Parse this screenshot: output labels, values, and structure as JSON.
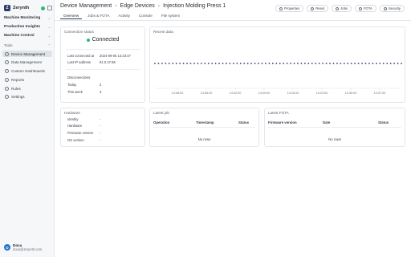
{
  "brand": {
    "name": "Zerynth",
    "logo_letter": "Z"
  },
  "sidebar": {
    "groups": [
      {
        "label": "Machine Monitoring"
      },
      {
        "label": "Production Insights"
      },
      {
        "label": "Machine Control"
      }
    ],
    "section": "Tools",
    "items": [
      {
        "label": "Device Management",
        "icon": "gear-icon",
        "active": true
      },
      {
        "label": "Data Management",
        "icon": "database-icon"
      },
      {
        "label": "Custom Dashboards",
        "icon": "dashboard-icon"
      },
      {
        "label": "Reports",
        "icon": "report-icon"
      },
      {
        "label": "Rules",
        "icon": "rules-icon"
      },
      {
        "label": "Settings",
        "icon": "settings-icon"
      }
    ],
    "user": {
      "initial": "D",
      "name": "Doca",
      "email": "doca@zerynth.com"
    }
  },
  "header": {
    "crumbs": [
      "Device Management",
      "Edge Devices",
      "Injection Molding Press 1"
    ],
    "actions": [
      "Properties",
      "Reset",
      "Jobs",
      "FOTA",
      "Security"
    ],
    "tabs": [
      "Overview",
      "Jobs & FOTA",
      "Activity",
      "Console",
      "File system"
    ],
    "active_tab": "Overview"
  },
  "connection": {
    "title": "Connection status",
    "status": "Connected",
    "last_connected_label": "Last connected at",
    "last_connected_value": "2024-09-05 14:23:47",
    "last_ip_label": "Last IP address",
    "last_ip_value": "91.0.47.96",
    "disconnections_title": "Disconnections",
    "today_label": "Today",
    "today_value": "2",
    "week_label": "This week",
    "week_value": "3"
  },
  "recent": {
    "title": "Recent data"
  },
  "chart_data": {
    "type": "scatter",
    "title": "Recent data",
    "xlabel": "",
    "ylabel": "",
    "x_ticks": [
      "13:48:00",
      "13:55:00",
      "14:02:00",
      "14:09:00",
      "14:16:00",
      "14:23:00",
      "14:30:00",
      "14:37:00"
    ],
    "points_count": 70,
    "y_value": 0.5,
    "ylim": [
      0,
      1
    ],
    "grid": false,
    "color": "#2b3a67"
  },
  "hardware": {
    "title": "Hardware",
    "rows": [
      {
        "label": "Identity",
        "value": "-"
      },
      {
        "label": "Hardware",
        "value": "-"
      },
      {
        "label": "Firmware version",
        "value": "-"
      },
      {
        "label": "OS version",
        "value": "-"
      }
    ]
  },
  "latest_job": {
    "title": "Latest job",
    "cols": [
      "Operation",
      "Timestamp",
      "Status"
    ],
    "empty": "No rows"
  },
  "latest_fota": {
    "title": "Latest FOTA",
    "cols": [
      "Firmware version",
      "Date",
      "Status"
    ],
    "empty": "No rows"
  }
}
